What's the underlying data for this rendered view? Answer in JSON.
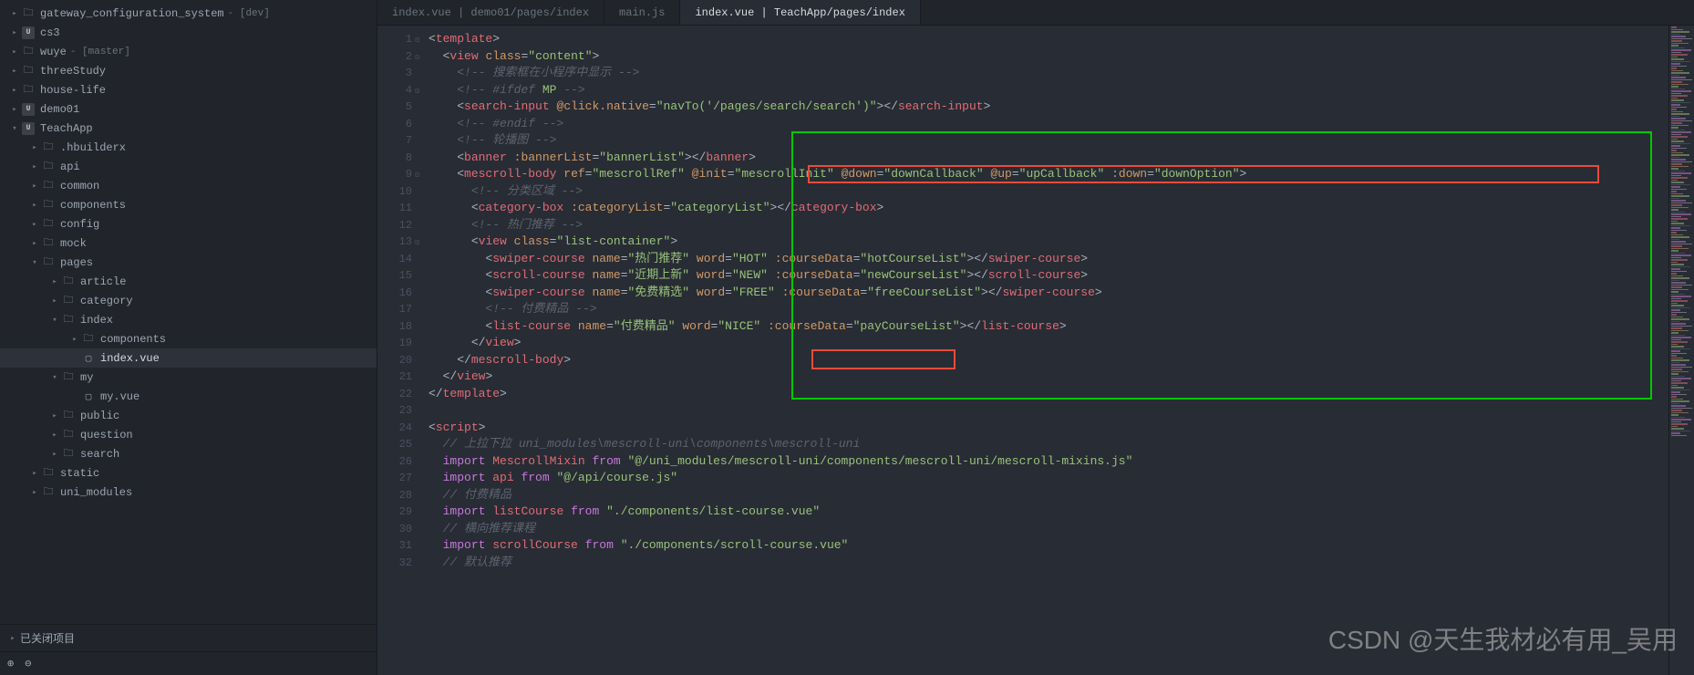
{
  "sidebar": {
    "projects": [
      {
        "arrow": "▸",
        "icon": "folder",
        "name": "gateway_configuration_system",
        "branch": "- [dev]",
        "indent": 10
      },
      {
        "arrow": "▸",
        "icon": "proj",
        "projLabel": "U",
        "name": "cs3",
        "indent": 10
      },
      {
        "arrow": "▸",
        "icon": "folder",
        "name": "wuye",
        "branch": "- [master]",
        "indent": 10
      },
      {
        "arrow": "▸",
        "icon": "folder",
        "name": "threeStudy",
        "indent": 10
      },
      {
        "arrow": "▸",
        "icon": "folder",
        "name": "house-life",
        "indent": 10
      },
      {
        "arrow": "▸",
        "icon": "proj",
        "projLabel": "U",
        "name": "demo01",
        "indent": 10
      },
      {
        "arrow": "▾",
        "icon": "proj",
        "projLabel": "U",
        "name": "TeachApp",
        "indent": 10
      },
      {
        "arrow": "▸",
        "icon": "folder",
        "name": ".hbuilderx",
        "indent": 32
      },
      {
        "arrow": "▸",
        "icon": "folder",
        "name": "api",
        "indent": 32
      },
      {
        "arrow": "▸",
        "icon": "folder",
        "name": "common",
        "indent": 32
      },
      {
        "arrow": "▸",
        "icon": "folder",
        "name": "components",
        "indent": 32
      },
      {
        "arrow": "▸",
        "icon": "folder",
        "name": "config",
        "indent": 32
      },
      {
        "arrow": "▸",
        "icon": "folder",
        "name": "mock",
        "indent": 32
      },
      {
        "arrow": "▾",
        "icon": "folder",
        "name": "pages",
        "indent": 32
      },
      {
        "arrow": "▸",
        "icon": "folder",
        "name": "article",
        "indent": 54
      },
      {
        "arrow": "▸",
        "icon": "folder",
        "name": "category",
        "indent": 54
      },
      {
        "arrow": "▾",
        "icon": "folder",
        "name": "index",
        "indent": 54
      },
      {
        "arrow": "▸",
        "icon": "folder",
        "name": "components",
        "indent": 76
      },
      {
        "arrow": "",
        "icon": "file",
        "name": "index.vue",
        "indent": 76,
        "active": true
      },
      {
        "arrow": "▾",
        "icon": "folder",
        "name": "my",
        "indent": 54
      },
      {
        "arrow": "",
        "icon": "file",
        "name": "my.vue",
        "indent": 76
      },
      {
        "arrow": "▸",
        "icon": "folder",
        "name": "public",
        "indent": 54
      },
      {
        "arrow": "▸",
        "icon": "folder",
        "name": "question",
        "indent": 54
      },
      {
        "arrow": "▸",
        "icon": "folder",
        "name": "search",
        "indent": 54
      },
      {
        "arrow": "▸",
        "icon": "folder",
        "name": "static",
        "indent": 32
      },
      {
        "arrow": "▸",
        "icon": "folder",
        "name": "uni_modules",
        "indent": 32
      }
    ],
    "closedLabel": "已关闭项目",
    "statusIcons": [
      "⊕",
      "⊖"
    ]
  },
  "tabs": [
    {
      "label": "index.vue | demo01/pages/index",
      "active": false
    },
    {
      "label": "main.js",
      "active": false
    },
    {
      "label": "index.vue | TeachApp/pages/index",
      "active": true
    }
  ],
  "editor": {
    "lines": [
      {
        "n": 1,
        "html": "<span class='c-punct'>&lt;</span><span class='c-tag'>template</span><span class='c-punct'>&gt;</span>",
        "fold": "▾"
      },
      {
        "n": 2,
        "html": "  <span class='c-punct'>&lt;</span><span class='c-tag'>view</span> <span class='c-attr'>class</span><span class='c-punct'>=</span><span class='c-str'>\"content\"</span><span class='c-punct'>&gt;</span>",
        "fold": "▾"
      },
      {
        "n": 3,
        "html": "    <span class='c-comment'>&lt;!-- 搜索框在小程序中显示 --&gt;</span>"
      },
      {
        "n": 4,
        "html": "    <span class='c-comment'>&lt;!-- #ifdef </span><span class='c-mp'>MP</span><span class='c-comment'> --&gt;</span>",
        "fold": "▾"
      },
      {
        "n": 5,
        "html": "    <span class='c-punct'>&lt;</span><span class='c-tag'>search-input</span> <span class='c-attr'>@click.native</span><span class='c-punct'>=</span><span class='c-str'>\"navTo('/pages/search/search')\"</span><span class='c-punct'>&gt;&lt;/</span><span class='c-tag'>search-input</span><span class='c-punct'>&gt;</span>"
      },
      {
        "n": 6,
        "html": "    <span class='c-comment'>&lt;!-- #endif --&gt;</span>"
      },
      {
        "n": 7,
        "html": "    <span class='c-comment'>&lt;!-- 轮播图 --&gt;</span>"
      },
      {
        "n": 8,
        "html": "    <span class='c-punct'>&lt;</span><span class='c-tag'>banner</span> <span class='c-attr'>:bannerList</span><span class='c-punct'>=</span><span class='c-str'>\"bannerList\"</span><span class='c-punct'>&gt;&lt;/</span><span class='c-tag'>banner</span><span class='c-punct'>&gt;</span>"
      },
      {
        "n": 9,
        "html": "    <span class='c-punct'>&lt;</span><span class='c-tag'>mescroll-body</span> <span class='c-attr'>ref</span><span class='c-punct'>=</span><span class='c-str'>\"mescrollRef\"</span> <span class='c-attr'>@init</span><span class='c-punct'>=</span><span class='c-str'>\"mescrollInit\"</span> <span class='c-attr'>@down</span><span class='c-punct'>=</span><span class='c-str'>\"downCallback\"</span> <span class='c-attr'>@up</span><span class='c-punct'>=</span><span class='c-str'>\"upCallback\"</span> <span class='c-attr'>:down</span><span class='c-punct'>=</span><span class='c-str'>\"downOption\"</span><span class='c-punct'>&gt;</span>",
        "fold": "▾"
      },
      {
        "n": 10,
        "html": "      <span class='c-comment'>&lt;!-- 分类区域 --&gt;</span>"
      },
      {
        "n": 11,
        "html": "      <span class='c-punct'>&lt;</span><span class='c-tag'>category-box</span> <span class='c-attr'>:categoryList</span><span class='c-punct'>=</span><span class='c-str'>\"categoryList\"</span><span class='c-punct'>&gt;&lt;/</span><span class='c-tag'>category-box</span><span class='c-punct'>&gt;</span>"
      },
      {
        "n": 12,
        "html": "      <span class='c-comment'>&lt;!-- 热门推荐 --&gt;</span>"
      },
      {
        "n": 13,
        "html": "      <span class='c-punct'>&lt;</span><span class='c-tag'>view</span> <span class='c-attr'>class</span><span class='c-punct'>=</span><span class='c-str'>\"list-container\"</span><span class='c-punct'>&gt;</span>",
        "fold": "▾"
      },
      {
        "n": 14,
        "html": "        <span class='c-punct'>&lt;</span><span class='c-tag'>swiper-course</span> <span class='c-attr'>name</span><span class='c-punct'>=</span><span class='c-str'>\"热门推荐\"</span> <span class='c-attr'>word</span><span class='c-punct'>=</span><span class='c-str'>\"HOT\"</span> <span class='c-attr'>:courseData</span><span class='c-punct'>=</span><span class='c-str'>\"hotCourseList\"</span><span class='c-punct'>&gt;&lt;/</span><span class='c-tag'>swiper-course</span><span class='c-punct'>&gt;</span>"
      },
      {
        "n": 15,
        "html": "        <span class='c-punct'>&lt;</span><span class='c-tag'>scroll-course</span> <span class='c-attr'>name</span><span class='c-punct'>=</span><span class='c-str'>\"近期上新\"</span> <span class='c-attr'>word</span><span class='c-punct'>=</span><span class='c-str'>\"NEW\"</span> <span class='c-attr'>:courseData</span><span class='c-punct'>=</span><span class='c-str'>\"newCourseList\"</span><span class='c-punct'>&gt;&lt;/</span><span class='c-tag'>scroll-course</span><span class='c-punct'>&gt;</span>"
      },
      {
        "n": 16,
        "html": "        <span class='c-punct'>&lt;</span><span class='c-tag'>swiper-course</span> <span class='c-attr'>name</span><span class='c-punct'>=</span><span class='c-str'>\"免费精选\"</span> <span class='c-attr'>word</span><span class='c-punct'>=</span><span class='c-str'>\"FREE\"</span> <span class='c-attr'>:courseData</span><span class='c-punct'>=</span><span class='c-str'>\"freeCourseList\"</span><span class='c-punct'>&gt;&lt;/</span><span class='c-tag'>swiper-course</span><span class='c-punct'>&gt;</span>"
      },
      {
        "n": 17,
        "html": "        <span class='c-comment'>&lt;!-- 付费精品 --&gt;</span>"
      },
      {
        "n": 18,
        "html": "        <span class='c-punct'>&lt;</span><span class='c-tag'>list-course</span> <span class='c-attr'>name</span><span class='c-punct'>=</span><span class='c-str'>\"付费精品\"</span> <span class='c-attr'>word</span><span class='c-punct'>=</span><span class='c-str'>\"NICE\"</span> <span class='c-attr'>:courseData</span><span class='c-punct'>=</span><span class='c-str'>\"payCourseList\"</span><span class='c-punct'>&gt;&lt;/</span><span class='c-tag'>list-course</span><span class='c-punct'>&gt;</span>"
      },
      {
        "n": 19,
        "html": "      <span class='c-punct'>&lt;/</span><span class='c-tag'>view</span><span class='c-punct'>&gt;</span>"
      },
      {
        "n": 20,
        "html": "    <span class='c-punct'>&lt;/</span><span class='c-tag'>mescroll-body</span><span class='c-punct'>&gt;</span>"
      },
      {
        "n": 21,
        "html": "  <span class='c-punct'>&lt;/</span><span class='c-tag'>view</span><span class='c-punct'>&gt;</span>"
      },
      {
        "n": 22,
        "html": "<span class='c-punct'>&lt;/</span><span class='c-tag'>template</span><span class='c-punct'>&gt;</span>"
      },
      {
        "n": 23,
        "html": ""
      },
      {
        "n": 24,
        "html": "<span class='c-punct'>&lt;</span><span class='c-tag'>script</span><span class='c-punct'>&gt;</span>"
      },
      {
        "n": 25,
        "html": "  <span class='c-comment'>// 上拉下拉 uni_modules\\mescroll-uni\\components\\mescroll-uni</span>"
      },
      {
        "n": 26,
        "html": "  <span class='c-kw'>import</span> <span class='c-var'>MescrollMixin</span> <span class='c-kw'>from</span> <span class='c-str'>\"@/uni_modules/mescroll-uni/components/mescroll-uni/mescroll-mixins.js\"</span>"
      },
      {
        "n": 27,
        "html": "  <span class='c-kw'>import</span> <span class='c-var'>api</span> <span class='c-kw'>from</span> <span class='c-str'>\"@/api/course.js\"</span>"
      },
      {
        "n": 28,
        "html": "  <span class='c-comment'>// 付费精品</span>"
      },
      {
        "n": 29,
        "html": "  <span class='c-kw'>import</span> <span class='c-var'>listCourse</span> <span class='c-kw'>from</span> <span class='c-str'>\"./components/list-course.vue\"</span>"
      },
      {
        "n": 30,
        "html": "  <span class='c-comment'>// 横向推荐课程</span>"
      },
      {
        "n": 31,
        "html": "  <span class='c-kw'>import</span> <span class='c-var'>scrollCourse</span> <span class='c-kw'>from</span> <span class='c-str'>\"./components/scroll-course.vue\"</span>"
      },
      {
        "n": 32,
        "html": "  <span class='c-comment'>// 默认推荐</span>"
      }
    ]
  },
  "watermark": "CSDN @天生我材必有用_吴用"
}
